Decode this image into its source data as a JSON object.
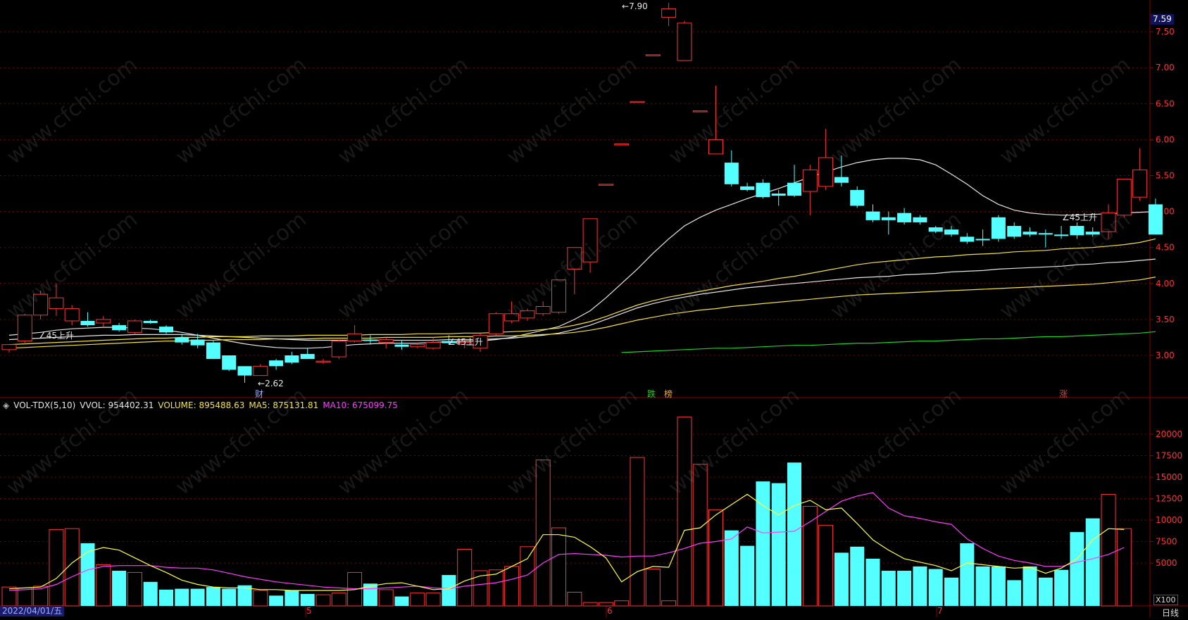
{
  "watermark": "www.cfchi.com",
  "price_axis": {
    "labels": [
      "7.50",
      "7.00",
      "6.50",
      "6.00",
      "5.50",
      "5.00",
      "4.50",
      "4.00",
      "3.50",
      "3.00"
    ]
  },
  "volume_axis": {
    "labels": [
      "20000",
      "17500",
      "15000",
      "12500",
      "10000",
      "7500",
      "5000"
    ]
  },
  "last_price": "7.59",
  "peak_label": "7.90",
  "trough_label": "2.62",
  "signal_label": "∠45上升",
  "flags": {
    "cai": "财",
    "die": "跌",
    "bang": "榜",
    "zhang": "涨"
  },
  "volume_legend": {
    "name": "VOL-TDX(5,10)",
    "vvol": "VVOL: 954402.31",
    "volume": "VOLUME: 895488.63",
    "ma5": "MA5: 875131.81",
    "ma10": "MA10: 675099.75"
  },
  "x_axis": {
    "start": "2022/04/01/五",
    "months": [
      "5",
      "6",
      "7"
    ]
  },
  "period": "日线",
  "vol_unit": "X100",
  "colors": {
    "up": "#ff3232",
    "down": "#54ffff",
    "ma_white": "#e6e6e6",
    "ma_yellow": "#f5e23c",
    "ma_green": "#1fd21f",
    "ma5_vol": "#ffff3c",
    "ma10_vol": "#ff3cff",
    "grid": "#7a0000"
  },
  "chart_data": [
    {
      "type": "candlestick",
      "title": "",
      "ylim": [
        2.5,
        7.9
      ],
      "yticks": [
        3.0,
        3.5,
        4.0,
        4.5,
        5.0,
        5.5,
        6.0,
        6.5,
        7.0,
        7.5
      ],
      "candles": [
        {
          "o": 3.08,
          "h": 3.15,
          "l": 3.04,
          "c": 3.15
        },
        {
          "o": 3.2,
          "h": 3.58,
          "l": 3.15,
          "c": 3.56
        },
        {
          "o": 3.56,
          "h": 3.9,
          "l": 3.5,
          "c": 3.85
        },
        {
          "o": 3.65,
          "h": 4.0,
          "l": 3.55,
          "c": 3.8
        },
        {
          "o": 3.48,
          "h": 3.7,
          "l": 3.42,
          "c": 3.65
        },
        {
          "o": 3.48,
          "h": 3.6,
          "l": 3.4,
          "c": 3.42
        },
        {
          "o": 3.45,
          "h": 3.55,
          "l": 3.4,
          "c": 3.5
        },
        {
          "o": 3.42,
          "h": 3.45,
          "l": 3.33,
          "c": 3.35
        },
        {
          "o": 3.32,
          "h": 3.5,
          "l": 3.3,
          "c": 3.48
        },
        {
          "o": 3.48,
          "h": 3.5,
          "l": 3.44,
          "c": 3.45
        },
        {
          "o": 3.4,
          "h": 3.42,
          "l": 3.3,
          "c": 3.32
        },
        {
          "o": 3.25,
          "h": 3.3,
          "l": 3.15,
          "c": 3.18
        },
        {
          "o": 3.22,
          "h": 3.3,
          "l": 3.1,
          "c": 3.14
        },
        {
          "o": 3.18,
          "h": 3.2,
          "l": 2.95,
          "c": 2.95
        },
        {
          "o": 3.0,
          "h": 3.0,
          "l": 2.78,
          "c": 2.8
        },
        {
          "o": 2.85,
          "h": 2.85,
          "l": 2.62,
          "c": 2.72
        },
        {
          "o": 2.72,
          "h": 2.88,
          "l": 2.72,
          "c": 2.85
        },
        {
          "o": 2.93,
          "h": 2.95,
          "l": 2.8,
          "c": 2.85
        },
        {
          "o": 3.0,
          "h": 3.05,
          "l": 2.88,
          "c": 2.9
        },
        {
          "o": 3.02,
          "h": 3.1,
          "l": 2.95,
          "c": 2.95
        },
        {
          "o": 2.92,
          "h": 2.95,
          "l": 2.88,
          "c": 2.92
        },
        {
          "o": 2.98,
          "h": 3.22,
          "l": 2.95,
          "c": 3.2
        },
        {
          "o": 3.2,
          "h": 3.42,
          "l": 3.18,
          "c": 3.3
        },
        {
          "o": 3.22,
          "h": 3.28,
          "l": 3.15,
          "c": 3.2
        },
        {
          "o": 3.18,
          "h": 3.25,
          "l": 3.1,
          "c": 3.22
        },
        {
          "o": 3.15,
          "h": 3.2,
          "l": 3.08,
          "c": 3.12
        },
        {
          "o": 3.12,
          "h": 3.18,
          "l": 3.1,
          "c": 3.15
        },
        {
          "o": 3.1,
          "h": 3.25,
          "l": 3.08,
          "c": 3.18
        },
        {
          "o": 3.2,
          "h": 3.28,
          "l": 3.15,
          "c": 3.17
        },
        {
          "o": 3.15,
          "h": 3.22,
          "l": 3.1,
          "c": 3.18
        },
        {
          "o": 3.1,
          "h": 3.3,
          "l": 3.05,
          "c": 3.28
        },
        {
          "o": 3.3,
          "h": 3.6,
          "l": 3.28,
          "c": 3.58
        },
        {
          "o": 3.48,
          "h": 3.75,
          "l": 3.45,
          "c": 3.58
        },
        {
          "o": 3.52,
          "h": 3.65,
          "l": 3.48,
          "c": 3.62
        },
        {
          "o": 3.58,
          "h": 3.75,
          "l": 3.55,
          "c": 3.68
        },
        {
          "o": 3.6,
          "h": 3.68,
          "l": 3.58,
          "c": 4.05
        },
        {
          "o": 4.2,
          "h": 4.5,
          "l": 3.85,
          "c": 4.5
        },
        {
          "o": 4.3,
          "h": 4.9,
          "l": 4.15,
          "c": 4.9
        },
        {
          "o": 5.38,
          "h": 5.38,
          "l": 5.38,
          "c": 5.38
        },
        {
          "o": 5.94,
          "h": 5.94,
          "l": 5.94,
          "c": 5.94
        },
        {
          "o": 6.53,
          "h": 6.53,
          "l": 6.53,
          "c": 6.53
        },
        {
          "o": 7.18,
          "h": 7.18,
          "l": 7.18,
          "c": 7.18
        },
        {
          "o": 7.7,
          "h": 7.9,
          "l": 7.58,
          "c": 7.82
        },
        {
          "o": 7.1,
          "h": 7.65,
          "l": 7.1,
          "c": 7.62
        },
        {
          "o": 6.4,
          "h": 6.4,
          "l": 6.4,
          "c": 6.4
        },
        {
          "o": 5.8,
          "h": 6.75,
          "l": 5.8,
          "c": 6.0
        },
        {
          "o": 5.68,
          "h": 5.85,
          "l": 5.35,
          "c": 5.38
        },
        {
          "o": 5.35,
          "h": 5.4,
          "l": 5.28,
          "c": 5.3
        },
        {
          "o": 5.4,
          "h": 5.45,
          "l": 5.18,
          "c": 5.2
        },
        {
          "o": 5.25,
          "h": 5.3,
          "l": 5.08,
          "c": 5.22
        },
        {
          "o": 5.4,
          "h": 5.65,
          "l": 5.2,
          "c": 5.22
        },
        {
          "o": 5.28,
          "h": 5.65,
          "l": 4.95,
          "c": 5.58
        },
        {
          "o": 5.35,
          "h": 6.15,
          "l": 5.3,
          "c": 5.75
        },
        {
          "o": 5.48,
          "h": 5.78,
          "l": 5.35,
          "c": 5.4
        },
        {
          "o": 5.3,
          "h": 5.35,
          "l": 5.05,
          "c": 5.08
        },
        {
          "o": 5.0,
          "h": 5.1,
          "l": 4.85,
          "c": 4.88
        },
        {
          "o": 4.92,
          "h": 5.0,
          "l": 4.68,
          "c": 4.88
        },
        {
          "o": 4.98,
          "h": 5.05,
          "l": 4.82,
          "c": 4.85
        },
        {
          "o": 4.92,
          "h": 4.95,
          "l": 4.82,
          "c": 4.85
        },
        {
          "o": 4.78,
          "h": 4.8,
          "l": 4.7,
          "c": 4.72
        },
        {
          "o": 4.75,
          "h": 4.8,
          "l": 4.65,
          "c": 4.68
        },
        {
          "o": 4.65,
          "h": 4.7,
          "l": 4.55,
          "c": 4.58
        },
        {
          "o": 4.62,
          "h": 4.75,
          "l": 4.52,
          "c": 4.6
        },
        {
          "o": 4.92,
          "h": 4.95,
          "l": 4.58,
          "c": 4.62
        },
        {
          "o": 4.8,
          "h": 4.85,
          "l": 4.62,
          "c": 4.65
        },
        {
          "o": 4.72,
          "h": 4.78,
          "l": 4.65,
          "c": 4.68
        },
        {
          "o": 4.7,
          "h": 4.75,
          "l": 4.5,
          "c": 4.68
        },
        {
          "o": 4.68,
          "h": 4.8,
          "l": 4.62,
          "c": 4.66
        },
        {
          "o": 4.8,
          "h": 4.85,
          "l": 4.62,
          "c": 4.67
        },
        {
          "o": 4.72,
          "h": 4.78,
          "l": 4.65,
          "c": 4.68
        },
        {
          "o": 4.72,
          "h": 5.1,
          "l": 4.62,
          "c": 4.98
        },
        {
          "o": 4.95,
          "h": 5.45,
          "l": 4.92,
          "c": 5.45
        },
        {
          "o": 5.2,
          "h": 5.88,
          "l": 5.15,
          "c": 5.58
        },
        {
          "o": 5.1,
          "h": 5.18,
          "l": 4.68,
          "c": 4.68
        }
      ],
      "ma_lines": [
        {
          "name": "",
          "color": "ma_white",
          "values": [
            3.28,
            3.3,
            3.32,
            3.35,
            3.37,
            3.38,
            3.39,
            3.39,
            3.38,
            3.37,
            3.35,
            3.32,
            3.28,
            3.24,
            3.2,
            3.16,
            3.13,
            3.11,
            3.1,
            3.1,
            3.11,
            3.13,
            3.15,
            3.16,
            3.17,
            3.17,
            3.17,
            3.18,
            3.19,
            3.2,
            3.2,
            3.22,
            3.25,
            3.3,
            3.35,
            3.4,
            3.5,
            3.62,
            3.8,
            4.0,
            4.2,
            4.42,
            4.62,
            4.8,
            4.92,
            5.02,
            5.1,
            5.18,
            5.25,
            5.32,
            5.4,
            5.48,
            5.55,
            5.62,
            5.68,
            5.72,
            5.74,
            5.74,
            5.72,
            5.65,
            5.52,
            5.38,
            5.22,
            5.1,
            5.02,
            4.98,
            4.96,
            4.95,
            4.95,
            4.96,
            4.97,
            4.98,
            4.99,
            5.0
          ]
        },
        {
          "name": "",
          "color": "ma_white",
          "values": [
            3.22,
            3.23,
            3.24,
            3.25,
            3.26,
            3.27,
            3.28,
            3.28,
            3.29,
            3.29,
            3.29,
            3.29,
            3.28,
            3.27,
            3.26,
            3.25,
            3.24,
            3.23,
            3.22,
            3.21,
            3.21,
            3.21,
            3.21,
            3.21,
            3.21,
            3.21,
            3.21,
            3.21,
            3.22,
            3.22,
            3.22,
            3.23,
            3.24,
            3.26,
            3.28,
            3.31,
            3.36,
            3.42,
            3.5,
            3.58,
            3.66,
            3.72,
            3.77,
            3.81,
            3.85,
            3.88,
            3.91,
            3.94,
            3.96,
            3.98,
            4.0,
            4.02,
            4.04,
            4.06,
            4.08,
            4.09,
            4.1,
            4.12,
            4.13,
            4.14,
            4.16,
            4.17,
            4.18,
            4.2,
            4.21,
            4.22,
            4.23,
            4.24,
            4.26,
            4.27,
            4.29,
            4.3,
            4.32,
            4.34
          ]
        },
        {
          "name": "",
          "color": "ma_yellow",
          "values": [
            3.15,
            3.16,
            3.17,
            3.18,
            3.19,
            3.2,
            3.21,
            3.22,
            3.23,
            3.24,
            3.24,
            3.25,
            3.25,
            3.26,
            3.26,
            3.26,
            3.27,
            3.27,
            3.27,
            3.28,
            3.28,
            3.28,
            3.28,
            3.29,
            3.29,
            3.29,
            3.3,
            3.3,
            3.3,
            3.31,
            3.31,
            3.32,
            3.33,
            3.34,
            3.36,
            3.38,
            3.42,
            3.47,
            3.54,
            3.62,
            3.7,
            3.76,
            3.81,
            3.85,
            3.89,
            3.93,
            3.97,
            4.0,
            4.03,
            4.07,
            4.1,
            4.14,
            4.18,
            4.22,
            4.26,
            4.29,
            4.31,
            4.33,
            4.35,
            4.37,
            4.38,
            4.4,
            4.41,
            4.42,
            4.44,
            4.45,
            4.46,
            4.48,
            4.49,
            4.5,
            4.52,
            4.54,
            4.57,
            4.62
          ]
        },
        {
          "name": "",
          "color": "ma_yellow",
          "values": [
            3.1,
            3.11,
            3.12,
            3.13,
            3.14,
            3.15,
            3.16,
            3.17,
            3.18,
            3.19,
            3.2,
            3.2,
            3.21,
            3.21,
            3.22,
            3.22,
            3.22,
            3.23,
            3.23,
            3.23,
            3.24,
            3.24,
            3.24,
            3.24,
            3.25,
            3.25,
            3.25,
            3.25,
            3.26,
            3.26,
            3.26,
            3.27,
            3.27,
            3.28,
            3.29,
            3.3,
            3.32,
            3.35,
            3.39,
            3.44,
            3.49,
            3.53,
            3.57,
            3.6,
            3.63,
            3.65,
            3.68,
            3.7,
            3.72,
            3.74,
            3.76,
            3.78,
            3.8,
            3.82,
            3.84,
            3.85,
            3.86,
            3.87,
            3.88,
            3.89,
            3.9,
            3.91,
            3.92,
            3.93,
            3.94,
            3.95,
            3.96,
            3.97,
            3.98,
            3.99,
            4.01,
            4.03,
            4.05,
            4.09
          ]
        },
        {
          "name": "",
          "color": "ma_green",
          "start_index": 39,
          "values": [
            3.04,
            3.05,
            3.06,
            3.07,
            3.08,
            3.09,
            3.1,
            3.1,
            3.11,
            3.12,
            3.13,
            3.14,
            3.14,
            3.15,
            3.16,
            3.17,
            3.17,
            3.18,
            3.19,
            3.2,
            3.2,
            3.21,
            3.22,
            3.23,
            3.23,
            3.24,
            3.25,
            3.26,
            3.26,
            3.27,
            3.28,
            3.29,
            3.3,
            3.31,
            3.33
          ]
        }
      ]
    },
    {
      "type": "bar",
      "title": "VOL-TDX(5,10)",
      "ylim": [
        0,
        22000
      ],
      "yticks": [
        5000,
        7500,
        10000,
        12500,
        15000,
        17500,
        20000
      ],
      "values": [
        2200,
        2100,
        2300,
        8900,
        9000,
        7300,
        4800,
        4100,
        3900,
        2800,
        1900,
        2000,
        2000,
        2200,
        2000,
        2400,
        1800,
        1200,
        1800,
        1400,
        1300,
        1500,
        3900,
        2600,
        1900,
        1100,
        1500,
        1500,
        3600,
        6600,
        4100,
        4200,
        4600,
        6900,
        17000,
        9100,
        1600,
        400,
        400,
        600,
        17300,
        4300,
        600,
        22000,
        16500,
        11200,
        8800,
        7000,
        14500,
        14300,
        16700,
        11600,
        9400,
        6200,
        6900,
        5500,
        4100,
        4100,
        4600,
        4300,
        3300,
        7300,
        4600,
        4600,
        3000,
        4600,
        3300,
        4200,
        8600,
        10200,
        13000,
        9000
      ],
      "ma5": [
        2000,
        2100,
        2200,
        3200,
        5000,
        6300,
        6800,
        6500,
        5600,
        4700,
        3900,
        3000,
        2500,
        2200,
        2100,
        2100,
        1900,
        1900,
        1800,
        1800,
        1800,
        1800,
        1900,
        2300,
        2600,
        2700,
        2300,
        1900,
        2000,
        2900,
        3500,
        3700,
        4600,
        5500,
        8300,
        8300,
        8000,
        6900,
        5600,
        2800,
        4000,
        4600,
        4500,
        8800,
        9100,
        10600,
        11800,
        13000,
        11700,
        10600,
        11700,
        12300,
        11200,
        11400,
        9600,
        7700,
        6500,
        5500,
        5100,
        4700,
        4100,
        5000,
        4800,
        4600,
        4400,
        4500,
        3800,
        4400,
        5500,
        7700,
        9000,
        8900
      ],
      "ma10": [
        1800,
        1900,
        2000,
        2500,
        3400,
        4200,
        4600,
        4700,
        4700,
        4700,
        4500,
        4400,
        4400,
        4200,
        3800,
        3400,
        3100,
        2800,
        2600,
        2400,
        2200,
        2100,
        2000,
        2000,
        2100,
        2200,
        2300,
        2100,
        2000,
        2300,
        2500,
        2700,
        3100,
        3600,
        5000,
        6000,
        6100,
        6000,
        5900,
        5700,
        5800,
        5800,
        6200,
        6700,
        7300,
        7500,
        7800,
        9200,
        8500,
        8600,
        8700,
        9800,
        11000,
        12200,
        12800,
        13200,
        11400,
        10500,
        10200,
        9800,
        9500,
        7800,
        6700,
        5800,
        5300,
        5000,
        4600,
        4600,
        5100,
        5500,
        6000,
        6800
      ]
    }
  ]
}
